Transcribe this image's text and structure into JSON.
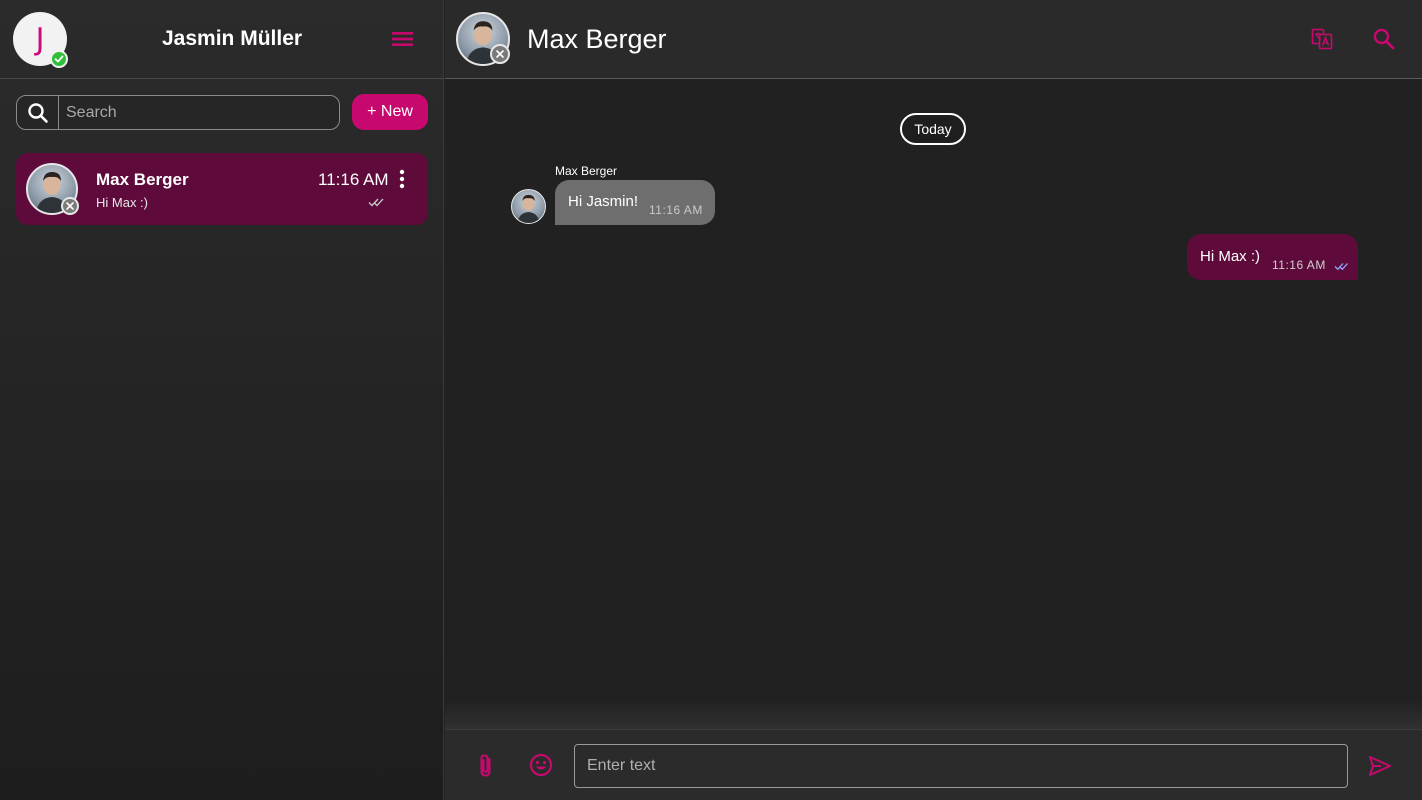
{
  "sidebar": {
    "user": {
      "initial": "J",
      "name": "Jasmin Müller",
      "status": "online"
    },
    "search": {
      "placeholder": "Search",
      "value": ""
    },
    "new_button": "+ New",
    "chats": [
      {
        "name": "Max Berger",
        "preview": "Hi Max :)",
        "time": "11:16 AM",
        "status": "offline",
        "read": true
      }
    ]
  },
  "conversation": {
    "contact_name": "Max Berger",
    "date_divider": "Today",
    "messages": [
      {
        "direction": "incoming",
        "sender": "Max Berger",
        "text": "Hi Jasmin!",
        "time": "11:16 AM"
      },
      {
        "direction": "outgoing",
        "text": "Hi Max :)",
        "time": "11:16 AM",
        "read": true
      }
    ]
  },
  "composer": {
    "placeholder": "Enter text",
    "value": ""
  },
  "icons": {
    "menu": "hamburger-menu-icon",
    "search": "search-icon",
    "translate": "translate-icon",
    "attach": "paperclip-icon",
    "emoji": "emoji-icon",
    "send": "send-icon",
    "more": "more-vertical-icon",
    "ticks": "double-check-icon"
  },
  "colors": {
    "accent": "#c7096f",
    "accent_dark": "#5e0b3b",
    "online": "#2fbf3a",
    "offline": "#7a7a7a",
    "incoming_bubble": "#6e6e6e",
    "read_tick": "#8fa8ff"
  }
}
